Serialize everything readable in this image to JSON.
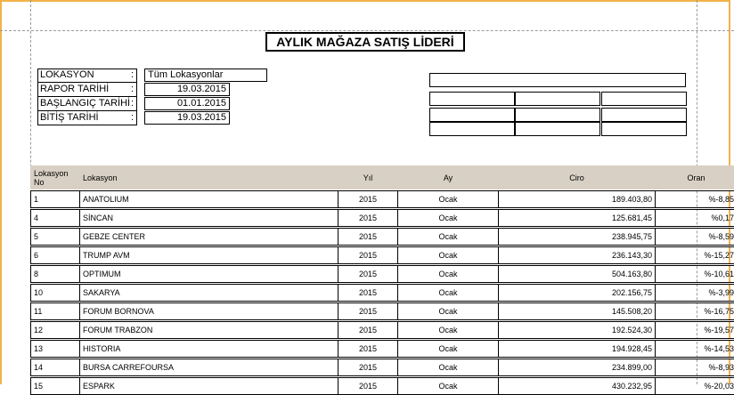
{
  "report": {
    "title": "AYLIK MAĞAZA SATIŞ LİDERİ",
    "params": [
      {
        "label": "LOKASYON",
        "colon": ":",
        "value": "Tüm Lokasyonlar"
      },
      {
        "label": "RAPOR TARİHİ",
        "colon": ":",
        "value": "19.03.2015"
      },
      {
        "label": "BAŞLANGIÇ TARİHİ",
        "colon": ":",
        "value": "01.01.2015"
      },
      {
        "label": "BİTİŞ TARİHİ",
        "colon": ":",
        "value": "19.03.2015"
      }
    ]
  },
  "table": {
    "headers": {
      "no": "Lokasyon No",
      "name": "Lokasyon",
      "year": "Yıl",
      "month": "Ay",
      "revenue": "Ciro",
      "ratio": "Oran"
    },
    "rows": [
      {
        "no": "1",
        "name": "ANATOLIUM",
        "year": "2015",
        "month": "Ocak",
        "revenue": "189.403,80",
        "ratio": "%-8,85"
      },
      {
        "no": "4",
        "name": "SİNCAN",
        "year": "2015",
        "month": "Ocak",
        "revenue": "125.681,45",
        "ratio": "%0,17"
      },
      {
        "no": "5",
        "name": "GEBZE CENTER",
        "year": "2015",
        "month": "Ocak",
        "revenue": "238.945,75",
        "ratio": "%-8,59"
      },
      {
        "no": "6",
        "name": "TRUMP AVM",
        "year": "2015",
        "month": "Ocak",
        "revenue": "236.143,30",
        "ratio": "%-15,27"
      },
      {
        "no": "8",
        "name": "OPTIMUM",
        "year": "2015",
        "month": "Ocak",
        "revenue": "504.163,80",
        "ratio": "%-10,61"
      },
      {
        "no": "10",
        "name": "SAKARYA",
        "year": "2015",
        "month": "Ocak",
        "revenue": "202.156,75",
        "ratio": "%-3,99"
      },
      {
        "no": "11",
        "name": "FORUM BORNOVA",
        "year": "2015",
        "month": "Ocak",
        "revenue": "145.508,20",
        "ratio": "%-16,75"
      },
      {
        "no": "12",
        "name": "FORUM TRABZON",
        "year": "2015",
        "month": "Ocak",
        "revenue": "192.524,30",
        "ratio": "%-19,57"
      },
      {
        "no": "13",
        "name": "HISTORIA",
        "year": "2015",
        "month": "Ocak",
        "revenue": "194.928,45",
        "ratio": "%-14,53"
      },
      {
        "no": "14",
        "name": "BURSA CARREFOURSA",
        "year": "2015",
        "month": "Ocak",
        "revenue": "234.899,00",
        "ratio": "%-8,93"
      },
      {
        "no": "15",
        "name": "ESPARK",
        "year": "2015",
        "month": "Ocak",
        "revenue": "430.232,95",
        "ratio": "%-20,03"
      }
    ]
  },
  "colors": {
    "frame_accent": "#f2b24a",
    "header_bg": "#d8d0c4"
  }
}
